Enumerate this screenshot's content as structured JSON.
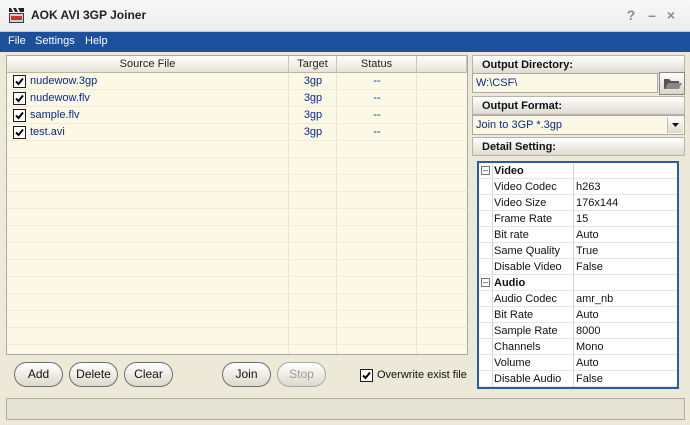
{
  "window": {
    "title": "AOK AVI 3GP Joiner",
    "controls": {
      "help": "?",
      "minimize": "–",
      "close": "×"
    }
  },
  "menu": [
    "File",
    "Settings",
    "Help"
  ],
  "file_list": {
    "columns": [
      "Source File",
      "Target",
      "Status"
    ],
    "rows": [
      {
        "checked": true,
        "name": "nudewow.3gp",
        "target": "3gp",
        "status": "--"
      },
      {
        "checked": true,
        "name": "nudewow.flv",
        "target": "3gp",
        "status": "--"
      },
      {
        "checked": true,
        "name": "sample.flv",
        "target": "3gp",
        "status": "--"
      },
      {
        "checked": true,
        "name": "test.avi",
        "target": "3gp",
        "status": "--"
      }
    ]
  },
  "buttons": {
    "add": "Add",
    "delete": "Delete",
    "clear": "Clear",
    "join": "Join",
    "stop": "Stop"
  },
  "overwrite": {
    "label": "Overwrite exist file",
    "checked": true
  },
  "output_directory": {
    "header": "Output Directory:",
    "value": "W:\\CSF\\"
  },
  "output_format": {
    "header": "Output Format:",
    "value": "Join to 3GP *.3gp"
  },
  "detail": {
    "header": "Detail Setting:",
    "categories": [
      {
        "name": "Video",
        "expander": "–",
        "props": [
          {
            "name": "Video Codec",
            "value": "h263"
          },
          {
            "name": "Video Size",
            "value": "176x144"
          },
          {
            "name": "Frame Rate",
            "value": "15"
          },
          {
            "name": "Bit rate",
            "value": "Auto"
          },
          {
            "name": "Same Quality",
            "value": "True"
          },
          {
            "name": "Disable Video",
            "value": "False"
          }
        ]
      },
      {
        "name": "Audio",
        "expander": "–",
        "props": [
          {
            "name": "Audio Codec",
            "value": "amr_nb"
          },
          {
            "name": "Bit Rate",
            "value": "Auto"
          },
          {
            "name": "Sample Rate",
            "value": "8000"
          },
          {
            "name": "Channels",
            "value": "Mono"
          },
          {
            "name": "Volume",
            "value": "Auto"
          },
          {
            "name": "Disable Audio",
            "value": "False"
          }
        ]
      }
    ]
  }
}
